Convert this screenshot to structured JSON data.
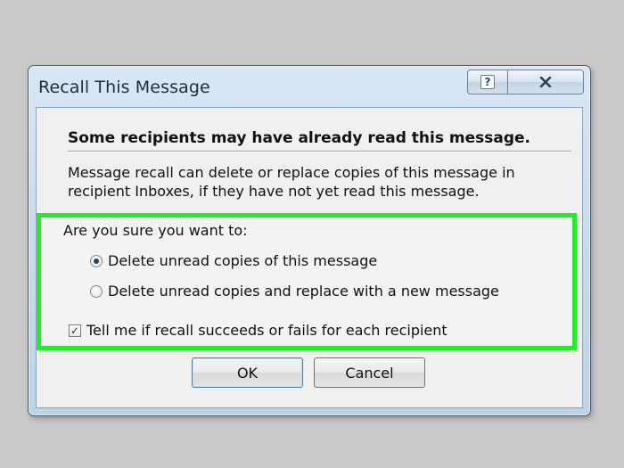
{
  "window": {
    "title": "Recall This Message",
    "help_glyph": "?",
    "close_glyph": "✕"
  },
  "content": {
    "heading": "Some recipients may have already read this message.",
    "description": "Message recall can delete or replace copies of this message in recipient Inboxes, if they have not yet read this message.",
    "confirm_label": "Are you sure you want to:",
    "options": [
      {
        "label": "Delete unread copies of this message",
        "selected": true
      },
      {
        "label": "Delete unread copies and replace with a new message",
        "selected": false
      }
    ],
    "notify": {
      "label": "Tell me if recall succeeds or fails for each recipient",
      "checked": true
    }
  },
  "buttons": {
    "ok": "OK",
    "cancel": "Cancel"
  },
  "colors": {
    "highlight_border": "#27ea2b",
    "title_bar": "#c8dced",
    "client_bg": "#f0f0f0"
  }
}
